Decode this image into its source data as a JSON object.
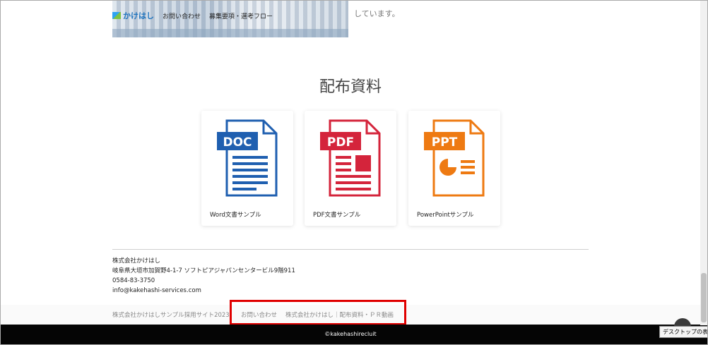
{
  "header": {
    "logo_text": "かけはし",
    "nav": [
      "お問い合わせ",
      "募集要項・選考フロー"
    ],
    "hero_text": "しています。"
  },
  "section": {
    "title": "配布資料"
  },
  "documents": [
    {
      "badge": "DOC",
      "label": "Word文書サンプル",
      "color": "#1f5fb0"
    },
    {
      "badge": "PDF",
      "label": "PDF文書サンプル",
      "color": "#d4243b"
    },
    {
      "badge": "PPT",
      "label": "PowerPointサンプル",
      "color": "#ee7a12"
    }
  ],
  "company": {
    "name": "株式会社かけはし",
    "address": "岐阜県大垣市加賀野4-1-7 ソフトピアジャパンセンタービル9階911",
    "phone": "0584-83-3750",
    "email": "info@kakehashi-services.com"
  },
  "footer": {
    "site_copy": "株式会社かけはしサンプル採用サイト2023",
    "links": [
      "お問い合わせ",
      "株式会社かけはし｜配布資料・ＰＲ動画"
    ],
    "copyright": "©kakehashirecluit"
  },
  "tooltip": "デスクトップの表示"
}
